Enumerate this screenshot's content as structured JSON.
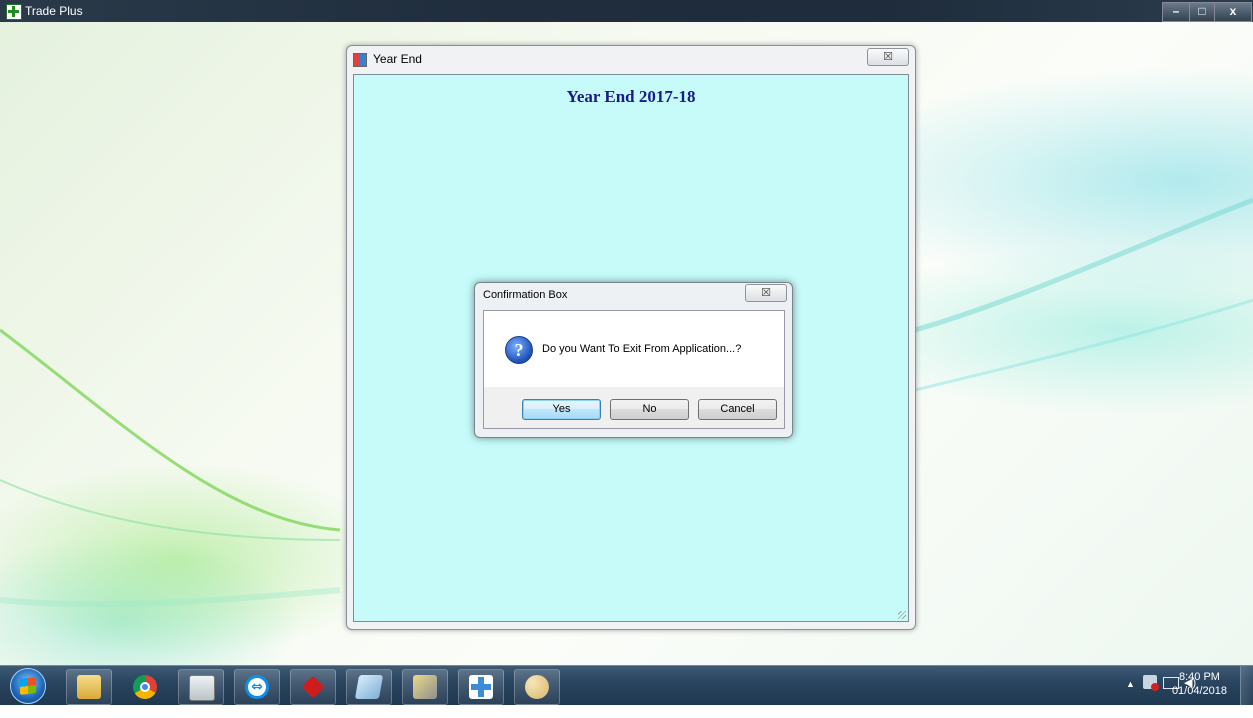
{
  "app": {
    "title": "Trade Plus",
    "controls": {
      "minimize": "–",
      "maximize": "□",
      "close": "x"
    }
  },
  "year_end_window": {
    "title": "Year End",
    "close_symbol": "☒",
    "heading": "Year End 2017-18"
  },
  "confirmation_dialog": {
    "title": "Confirmation Box",
    "close_symbol": "☒",
    "icon": "question-icon",
    "icon_glyph": "?",
    "message": "Do you Want To Exit From Application...?",
    "buttons": {
      "yes": "Yes",
      "no": "No",
      "cancel": "Cancel"
    },
    "default_button": "yes"
  },
  "taskbar": {
    "apps": [
      {
        "name": "file-explorer-icon",
        "color": "#e8c45a"
      },
      {
        "name": "chrome-icon",
        "color": "#db4437"
      },
      {
        "name": "calculator-icon",
        "color": "#dfe6e8"
      },
      {
        "name": "teamviewer-icon",
        "color": "#0e8ee9"
      },
      {
        "name": "red-diamond-icon",
        "color": "#d01c1c"
      },
      {
        "name": "notes-icon",
        "color": "#9ec4e0"
      },
      {
        "name": "tools-icon",
        "color": "#c9b55a"
      },
      {
        "name": "trade-plus-icon",
        "color": "#3b8bd8"
      },
      {
        "name": "paint-icon",
        "color": "#e6c98a"
      }
    ],
    "tray": {
      "arrow": "▲",
      "flag": "⚑",
      "network": "▭",
      "volume": "🔈"
    },
    "clock": {
      "time": "8:40 PM",
      "date": "01/04/2018"
    }
  },
  "colors": {
    "dialog_client_bg": "#c6fbfa",
    "heading_color": "#1a1a8a",
    "taskbar": "#2a4560"
  }
}
